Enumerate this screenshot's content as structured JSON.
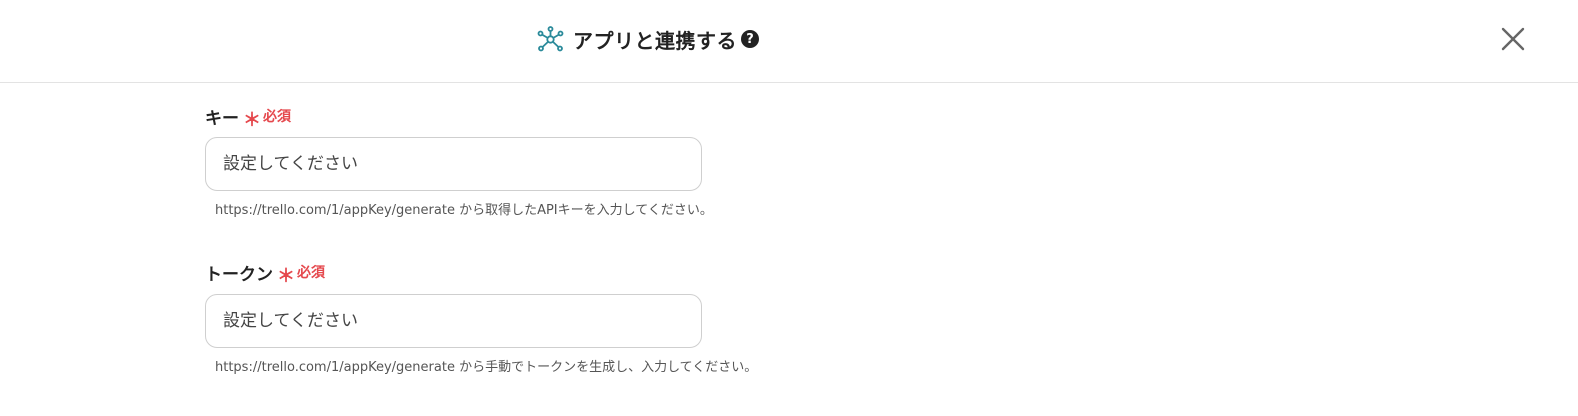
{
  "header": {
    "title": "アプリと連携する",
    "help_icon_text": "?",
    "icon": "network-hub-icon",
    "close_icon": "close-icon"
  },
  "fields": [
    {
      "label": "キー",
      "required_mark": "＊",
      "required_text": "必須",
      "value": "",
      "placeholder": "設定してください",
      "hint": "https://trello.com/1/appKey/generate から取得したAPIキーを入力してください。"
    },
    {
      "label": "トークン",
      "required_mark": "＊",
      "required_text": "必須",
      "value": "",
      "placeholder": "設定してください",
      "hint": "https://trello.com/1/appKey/generate から手動でトークンを生成し、入力してください。"
    }
  ],
  "colors": {
    "accent_icon": "#2a8a9a",
    "required": "#e5484d",
    "border": "#cfcfcf"
  }
}
